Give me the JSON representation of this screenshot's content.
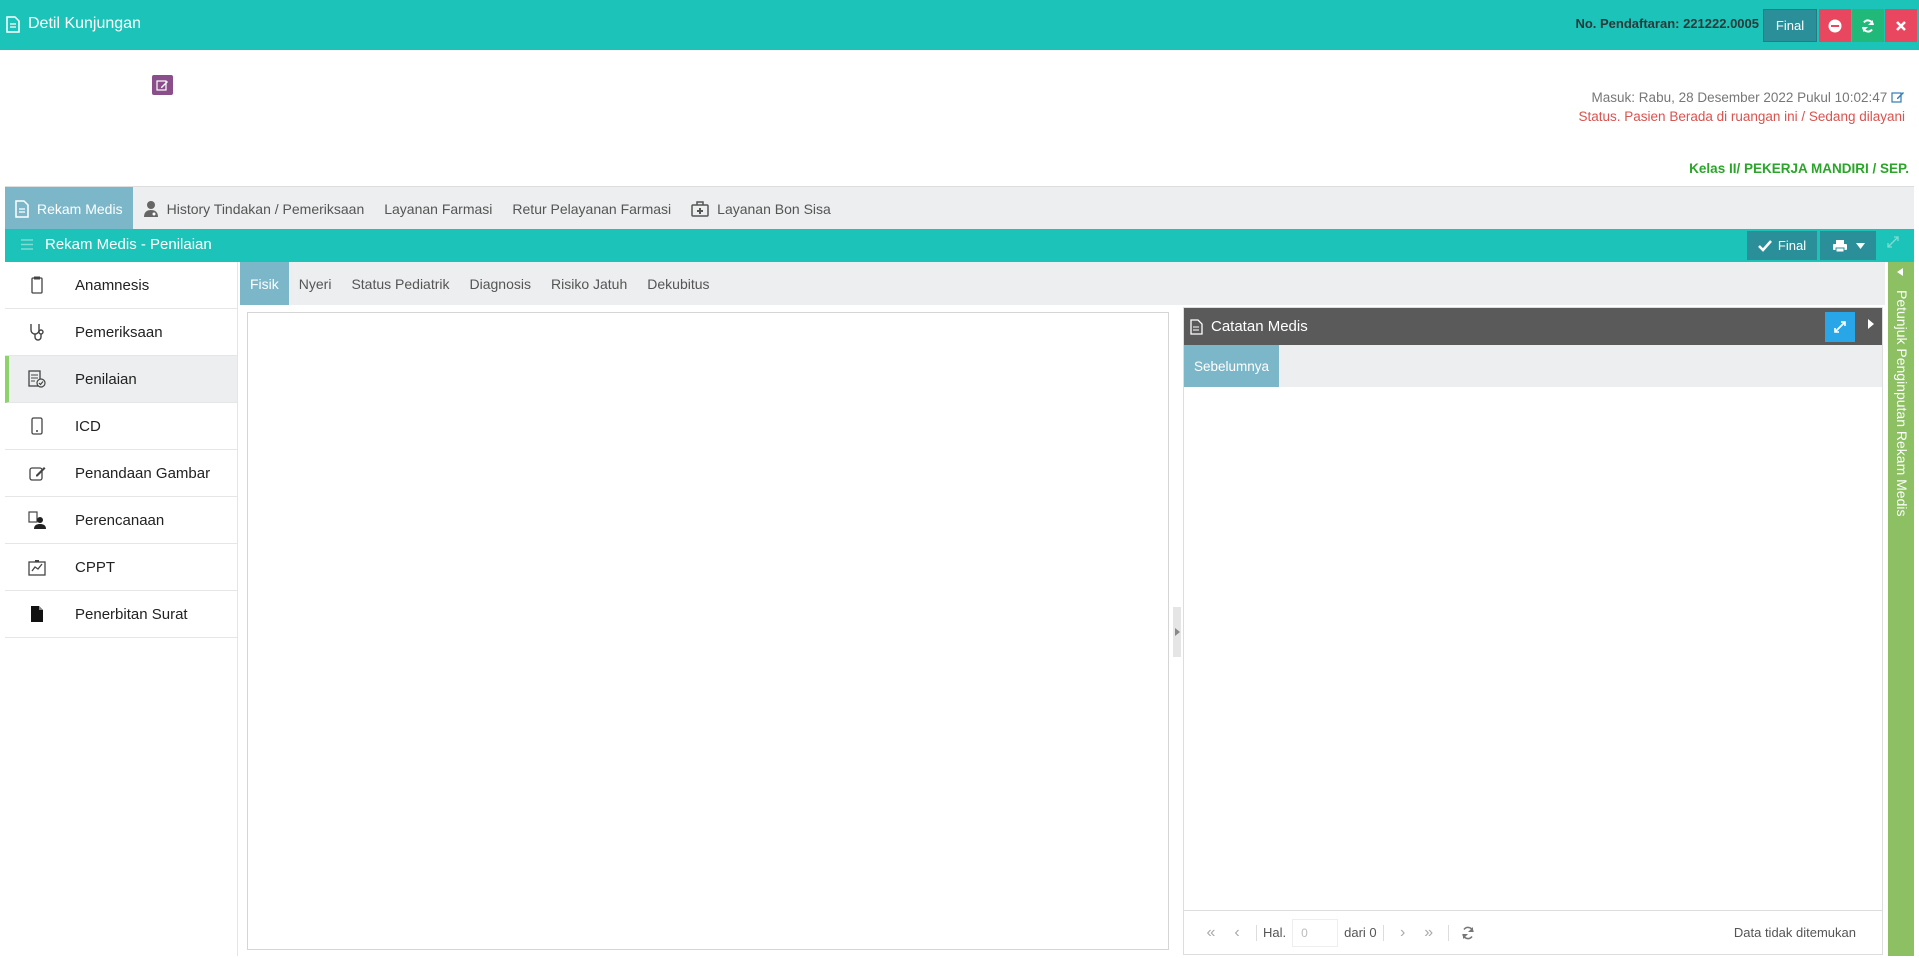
{
  "header": {
    "title": "Detil Kunjungan",
    "registration": "No. Pendaftaran: 221222.0005",
    "final_label": "Final"
  },
  "visit": {
    "masuk": "Masuk: Rabu, 28 Desember 2022 Pukul 10:02:47",
    "status": "Status. Pasien Berada di ruangan ini / Sedang dilayani",
    "kelas": "Kelas II/ PEKERJA MANDIRI / SEP."
  },
  "main_tabs": [
    {
      "label": "Rekam Medis",
      "icon": "document-icon"
    },
    {
      "label": "History Tindakan / Pemeriksaan",
      "icon": "user-doctor-icon"
    },
    {
      "label": "Layanan Farmasi"
    },
    {
      "label": "Retur Pelayanan Farmasi"
    },
    {
      "label": "Layanan Bon Sisa",
      "icon": "medkit-icon"
    }
  ],
  "section": {
    "title": "Rekam Medis - Penilaian",
    "final_label": "Final"
  },
  "sidebar": {
    "items": [
      {
        "label": "Anamnesis"
      },
      {
        "label": "Pemeriksaan"
      },
      {
        "label": "Penilaian"
      },
      {
        "label": "ICD"
      },
      {
        "label": "Penandaan Gambar"
      },
      {
        "label": "Perencanaan"
      },
      {
        "label": "CPPT"
      },
      {
        "label": "Penerbitan Surat"
      }
    ]
  },
  "sub_tabs": [
    "Fisik",
    "Nyeri",
    "Status Pediatrik",
    "Diagnosis",
    "Risiko Jatuh",
    "Dekubitus"
  ],
  "catatan": {
    "title": "Catatan Medis",
    "tab": "Sebelumnya",
    "page_label": "Hal.",
    "page_value": "0",
    "page_of": "dari 0",
    "empty_text": "Data tidak ditemukan"
  },
  "petunjuk": "Petunjuk Penginputan Rekam Medis",
  "colors": {
    "teal": "#1cc3b8",
    "tab_active": "#7cb7c9",
    "green_side": "#8cc063",
    "status_red": "#d9534f",
    "kelas_green": "#2aa52a"
  }
}
